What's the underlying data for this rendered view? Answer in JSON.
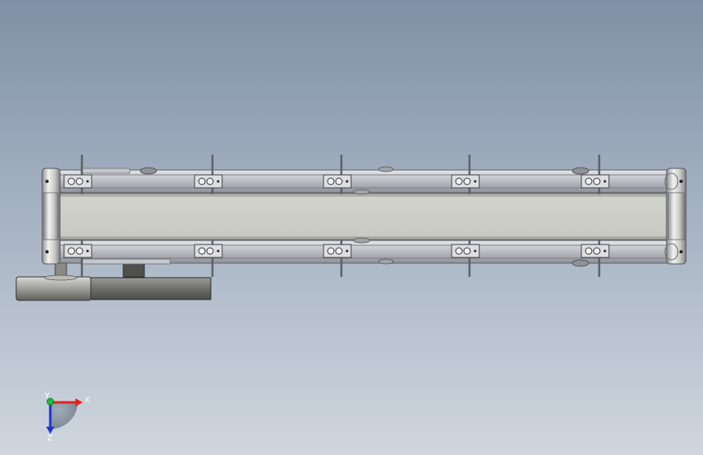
{
  "viewport": {
    "background_top": "#7f91a6",
    "background_bottom": "#cfd6de"
  },
  "model": {
    "name": "belt-conveyor",
    "colors": {
      "frame": "#bcc0c6",
      "frame_dark": "#6a6e74",
      "belt": "#c8c8c0",
      "roller": "#d6d6d0",
      "motor": "#7a7a78",
      "motor_dark": "#4a4a48"
    }
  },
  "triad": {
    "x_label": "X",
    "y_label": "Y",
    "z_label": "Z",
    "x_color": "#e4231c",
    "y_color": "#19c43a",
    "z_color": "#1d33d8"
  }
}
